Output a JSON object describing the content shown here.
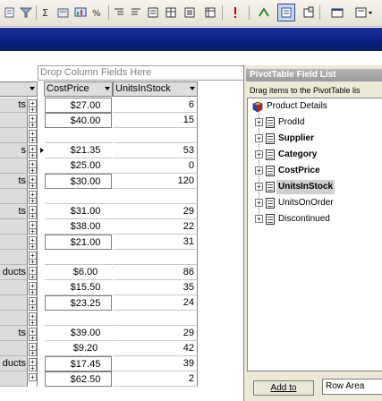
{
  "colors": {
    "title_band": "#0a1f7e",
    "header_gray": "#dedede",
    "panel": "#ece9d8",
    "selected_field": "#cfcfcf"
  },
  "toolbar": {
    "icons": [
      "paste-format-icon",
      "filter-icon",
      "autosum-icon",
      "chart-icon",
      "sort-icon",
      "percent-icon",
      "indent-icon",
      "properties-icon",
      "table-icon",
      "warning-icon",
      "refresh-icon",
      "field-list-icon",
      "settings-icon",
      "window-icon",
      "style-icon"
    ]
  },
  "pivot": {
    "drop_column_placeholder": "Drop Column Fields Here",
    "headers": {
      "cost_price": "CostPrice",
      "units_in_stock": "UnitsInStock"
    },
    "row_labels": [
      "ts",
      "",
      "",
      "s",
      "",
      "ts",
      "",
      "ts",
      "",
      "",
      "",
      "ducts",
      "",
      "",
      "",
      "ts",
      "",
      "ducts",
      ""
    ],
    "rows": [
      {
        "label": "ts",
        "cost": "$27.00",
        "units": "6"
      },
      {
        "label": "",
        "cost": "$40.00",
        "units": "15"
      },
      {
        "label": "",
        "cost": "",
        "units": ""
      },
      {
        "label": "s",
        "cost": "$21.35",
        "units": "53"
      },
      {
        "label": "",
        "cost": "$25.00",
        "units": "0"
      },
      {
        "label": "ts",
        "cost": "$30.00",
        "units": "120"
      },
      {
        "label": "",
        "cost": "",
        "units": ""
      },
      {
        "label": "ts",
        "cost": "$31.00",
        "units": "29"
      },
      {
        "label": "",
        "cost": "$38.00",
        "units": "22"
      },
      {
        "label": "",
        "cost": "$21.00",
        "units": "31"
      },
      {
        "label": "",
        "cost": "",
        "units": ""
      },
      {
        "label": "ducts",
        "cost": "$6.00",
        "units": "86"
      },
      {
        "label": "",
        "cost": "$15.50",
        "units": "35"
      },
      {
        "label": "",
        "cost": "$23.25",
        "units": "24"
      },
      {
        "label": "",
        "cost": "",
        "units": ""
      },
      {
        "label": "ts",
        "cost": "$39.00",
        "units": "29"
      },
      {
        "label": "",
        "cost": "$9.20",
        "units": "42"
      },
      {
        "label": "ducts",
        "cost": "$17.45",
        "units": "39"
      },
      {
        "label": "",
        "cost": "$62.50",
        "units": "2"
      }
    ]
  },
  "field_list": {
    "title": "PivotTable Field List",
    "instructions": "Drag items to the PivotTable lis",
    "root": "Product Details",
    "fields": [
      {
        "label": "ProdId",
        "bold": false
      },
      {
        "label": "Supplier",
        "bold": true
      },
      {
        "label": "Category",
        "bold": true
      },
      {
        "label": "CostPrice",
        "bold": true
      },
      {
        "label": "UnitsInStock",
        "bold": true
      },
      {
        "label": "UnitsOnOrder",
        "bold": false
      },
      {
        "label": "Discontinued",
        "bold": false
      }
    ],
    "add_to_label": "Add to",
    "area_value": "Row Area"
  }
}
